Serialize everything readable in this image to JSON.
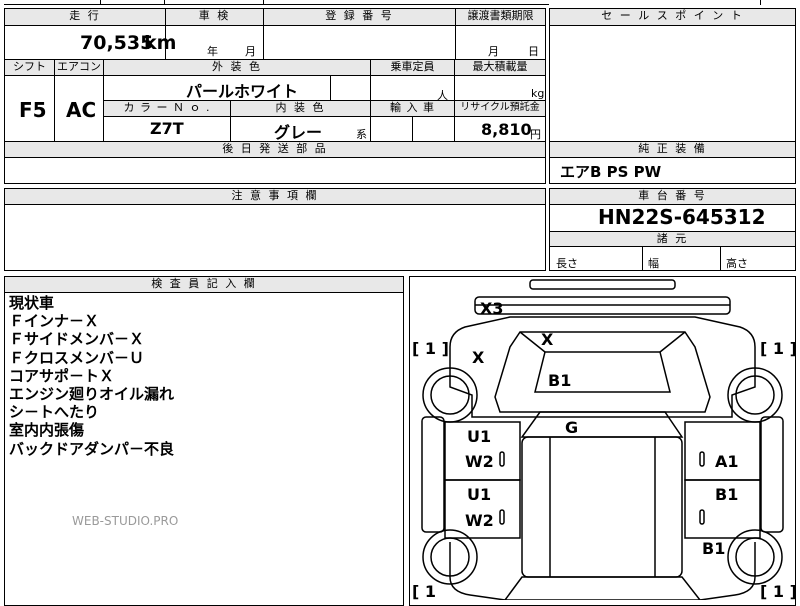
{
  "header": {
    "mileage_label": "走 行",
    "inspection_label": "車 検",
    "registration_label": "登 録 番 号",
    "transfer_deadline_label": "譲渡書類期限",
    "sales_point_label": "セ ー ル ス ポ イ ン ト"
  },
  "mileage": {
    "value": "70,535",
    "unit": "km"
  },
  "inspection": {
    "year_unit": "年",
    "month_unit": "月"
  },
  "transfer": {
    "month_unit": "月",
    "day_unit": "日"
  },
  "row2": {
    "shift_label": "シフト",
    "aircon_label": "エアコン",
    "exterior_color_label": "外 装 色",
    "capacity_label": "乗車定員",
    "max_load_label": "最大積載量",
    "shift_value": "F5",
    "aircon_value": "AC",
    "exterior_color_value": "パールホワイト",
    "capacity_unit": "人",
    "load_unit": "kg",
    "color_no_label": "カ ラ ー Ｎ ｏ .",
    "interior_color_label": "内 装 色",
    "import_label": "輸 入 車",
    "recycle_label": "リサイクル預託金",
    "color_no_value": "Z7T",
    "interior_color_value": "グレー",
    "interior_suffix": "系",
    "recycle_value": "8,810",
    "recycle_unit": "円"
  },
  "aftermarket_label": "後 日 発 送 部 品",
  "genuine_label": "純 正 装 備",
  "genuine_value": "エアB PS PW",
  "caution_label": "注 意 事 項 欄",
  "chassis": {
    "label": "車 台 番 号",
    "value": "HN22S-645312"
  },
  "dimensions": {
    "label": "諸 元",
    "length": "長さ",
    "width": "幅",
    "height": "高さ"
  },
  "inspector_label": "検 査 員 記 入 欄",
  "inspector_notes": [
    "現状車",
    "Ｆインナ－Ｘ",
    "Ｆサイドメンバ－Ｘ",
    "Ｆクロスメンバ－Ｕ",
    "コアサポ－トＸ",
    "エンジン廻りオイル漏れ",
    "シ－トへたり",
    "室内内張傷",
    "バックドアダンパ－不良"
  ],
  "watermark": "WEB-STUDIO.PRO",
  "diagram_marks": {
    "x3": "X3",
    "x_roof": "X",
    "x_left": "X",
    "b1_hood": "B1",
    "g": "G",
    "u1_top": "U1",
    "w2_top": "W2",
    "a1": "A1",
    "b1_right1": "B1",
    "u1_bottom": "U1",
    "w2_bottom": "W2",
    "b1_right2": "B1",
    "bracket_tl": "[ 1 ]",
    "bracket_tr": "[ 1 ]",
    "bracket_bl": "[ 1",
    "bracket_br": "[ 1 ]"
  }
}
